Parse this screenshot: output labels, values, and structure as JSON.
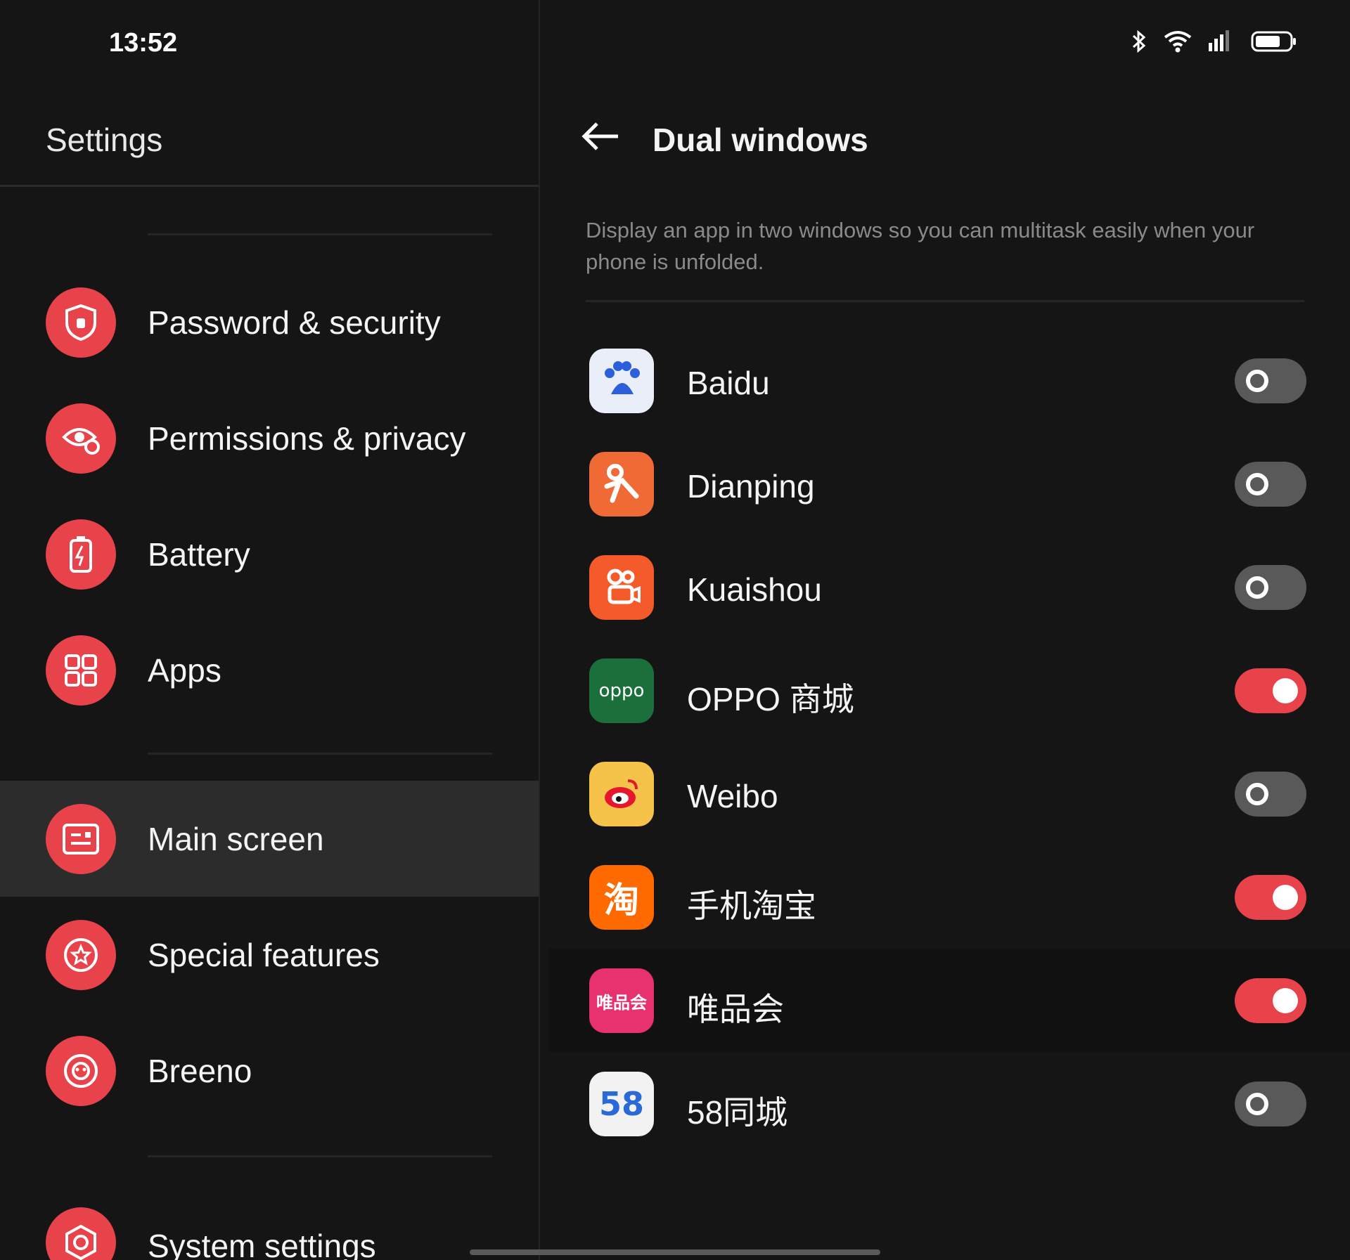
{
  "status_bar": {
    "time": "13:52",
    "icons": [
      "bluetooth-icon",
      "wifi-icon",
      "signal-icon",
      "battery-icon"
    ]
  },
  "sidebar": {
    "title": "Settings",
    "items": [
      {
        "label": "Password & security",
        "icon": "shield-icon",
        "selected": false
      },
      {
        "label": "Permissions & privacy",
        "icon": "privacy-eye-icon",
        "selected": false
      },
      {
        "label": "Battery",
        "icon": "battery-icon",
        "selected": false
      },
      {
        "label": "Apps",
        "icon": "apps-grid-icon",
        "selected": false
      },
      {
        "label": "Main screen",
        "icon": "main-screen-icon",
        "selected": true
      },
      {
        "label": "Special features",
        "icon": "star-icon",
        "selected": false
      },
      {
        "label": "Breeno",
        "icon": "breeno-icon",
        "selected": false
      },
      {
        "label": "System settings",
        "icon": "gear-icon",
        "selected": false
      }
    ]
  },
  "detail": {
    "title": "Dual windows",
    "description": "Display an app in two windows so you can multitask easily when your phone is unfolded.",
    "apps": [
      {
        "name": "Baidu",
        "icon": "baidu-icon",
        "enabled": false
      },
      {
        "name": "Dianping",
        "icon": "dianping-icon",
        "enabled": false
      },
      {
        "name": "Kuaishou",
        "icon": "kuaishou-icon",
        "enabled": false
      },
      {
        "name": "OPPO 商城",
        "icon": "oppo-store-icon",
        "icon_text": "oppo",
        "enabled": true
      },
      {
        "name": "Weibo",
        "icon": "weibo-icon",
        "enabled": false
      },
      {
        "name": "手机淘宝",
        "icon": "taobao-icon",
        "icon_text": "淘",
        "enabled": true
      },
      {
        "name": "唯品会",
        "icon": "vipshop-icon",
        "icon_text": "唯品会",
        "enabled": true
      },
      {
        "name": "58同城",
        "icon": "58-icon",
        "icon_text": "58",
        "enabled": false
      }
    ]
  },
  "colors": {
    "accent": "#e8434a",
    "background": "#151515",
    "selected_row": "#2c2c2c",
    "toggle_off": "#595959"
  }
}
